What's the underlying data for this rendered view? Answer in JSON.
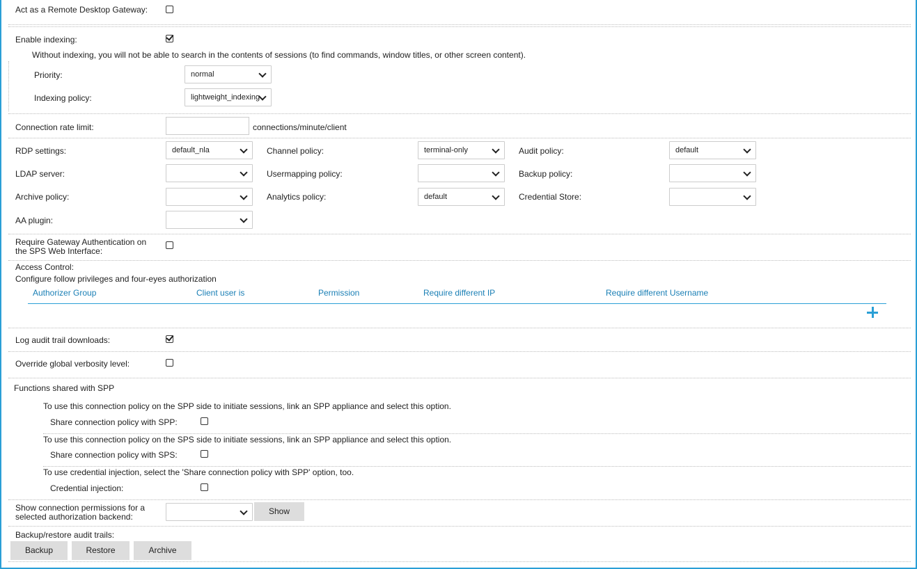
{
  "gateway": {
    "label": "Act as a Remote Desktop Gateway:",
    "checked": false
  },
  "indexing": {
    "label": "Enable indexing:",
    "checked": true,
    "note": "Without indexing, you will not be able to search in the contents of sessions (to find commands, window titles, or other screen content).",
    "priority_label": "Priority:",
    "priority_value": "normal",
    "policy_label": "Indexing policy:",
    "policy_value": "lightweight_indexing"
  },
  "rate_limit": {
    "label": "Connection rate limit:",
    "value": "",
    "unit": "connections/minute/client"
  },
  "settings": {
    "rdp_label": "RDP settings:",
    "rdp_value": "default_nla",
    "channel_label": "Channel policy:",
    "channel_value": "terminal-only",
    "audit_label": "Audit policy:",
    "audit_value": "default",
    "ldap_label": "LDAP server:",
    "ldap_value": "",
    "usermapping_label": "Usermapping policy:",
    "usermapping_value": "",
    "backup_label": "Backup policy:",
    "backup_value": "",
    "archive_label": "Archive policy:",
    "archive_value": "",
    "analytics_label": "Analytics policy:",
    "analytics_value": "default",
    "credstore_label": "Credential Store:",
    "credstore_value": "",
    "aa_label": "AA plugin:",
    "aa_value": ""
  },
  "gateway_auth": {
    "label_line1": "Require Gateway Authentication on",
    "label_line2": "the SPS Web Interface:",
    "checked": false
  },
  "access_control": {
    "title": "Access Control:",
    "description": "Configure follow privileges and four-eyes authorization",
    "columns": [
      "Authorizer Group",
      "Client user is",
      "Permission",
      "Require different IP",
      "Require different Username"
    ]
  },
  "log_audit": {
    "label": "Log audit trail downloads:",
    "checked": true
  },
  "verbosity": {
    "label": "Override global verbosity level:",
    "checked": false
  },
  "spp": {
    "title": "Functions shared with SPP",
    "note1": "To use this connection policy on the SPP side to initiate sessions, link an SPP appliance and select this option.",
    "share_spp_label": "Share connection policy with SPP:",
    "note2": "To use this connection policy on the SPS side to initiate sessions, link an SPP appliance and select this option.",
    "share_sps_label": "Share connection policy with SPS:",
    "note3": "To use credential injection, select the 'Share connection policy with SPP' option, too.",
    "cred_label": "Credential injection:"
  },
  "permissions": {
    "label_line1": "Show connection permissions for a",
    "label_line2": "selected authorization backend:",
    "value": "",
    "show_button": "Show"
  },
  "backup_restore": {
    "label": "Backup/restore audit trails:",
    "backup_button": "Backup",
    "restore_button": "Restore",
    "archive_button": "Archive"
  },
  "colors": {
    "accent": "#2a9fd6",
    "link": "#1a7fb5",
    "button_bg": "#dddddd"
  }
}
